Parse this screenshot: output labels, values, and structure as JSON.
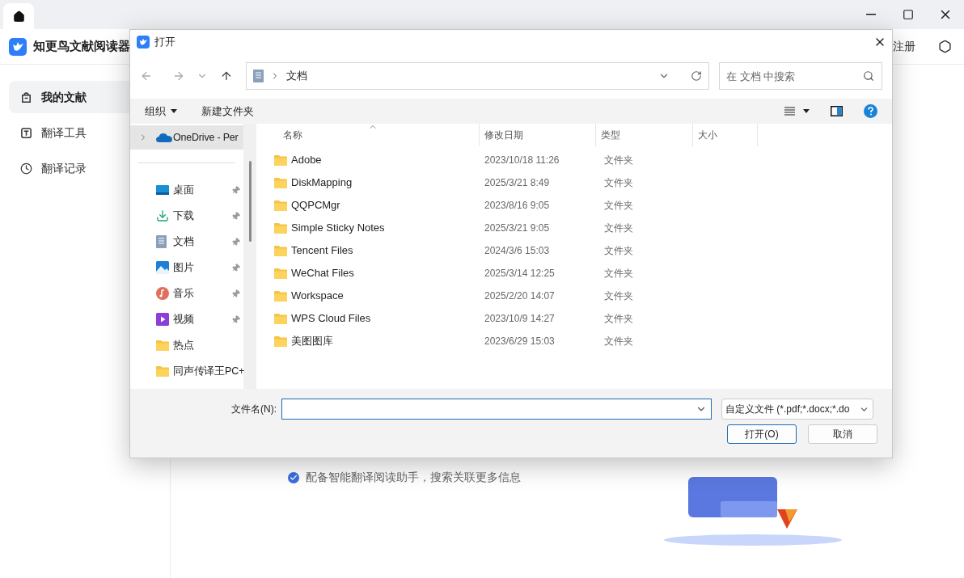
{
  "app": {
    "title": "知更鸟文献阅读器",
    "header_link": "注册",
    "sidebar": [
      {
        "label": "我的文献",
        "kind": "docs",
        "selected": true
      },
      {
        "label": "翻译工具",
        "kind": "translate",
        "selected": false
      },
      {
        "label": "翻译记录",
        "kind": "history",
        "selected": false
      }
    ],
    "option": {
      "label": "配备智能翻译阅读助手，搜索关联更多信息",
      "checked": true
    }
  },
  "dialog": {
    "title": "打开",
    "breadcrumb": "文档",
    "search": {
      "placeholder": "在 文档 中搜索"
    },
    "toolbar": [
      {
        "label": "组织",
        "dropdown": true
      },
      {
        "label": "新建文件夹",
        "dropdown": false
      }
    ],
    "nav": [
      {
        "label": "OneDrive - Per",
        "kind": "cloud",
        "pinned": false,
        "selected": true,
        "expandable": true
      },
      {
        "label": "桌面",
        "kind": "desktop",
        "pinned": true,
        "selected": false,
        "expandable": false
      },
      {
        "label": "下载",
        "kind": "download",
        "pinned": true,
        "selected": false,
        "expandable": false
      },
      {
        "label": "文档",
        "kind": "docs",
        "pinned": true,
        "selected": false,
        "expandable": false
      },
      {
        "label": "图片",
        "kind": "pictures",
        "pinned": true,
        "selected": false,
        "expandable": false
      },
      {
        "label": "音乐",
        "kind": "music",
        "pinned": true,
        "selected": false,
        "expandable": false
      },
      {
        "label": "视频",
        "kind": "video",
        "pinned": true,
        "selected": false,
        "expandable": false
      },
      {
        "label": "热点",
        "kind": "folder",
        "pinned": false,
        "selected": false,
        "expandable": false
      },
      {
        "label": "同声传译王PC+",
        "kind": "folder",
        "pinned": false,
        "selected": false,
        "expandable": false
      }
    ],
    "columns": [
      {
        "label": "名称",
        "sorted": true
      },
      {
        "label": "修改日期",
        "sorted": false
      },
      {
        "label": "类型",
        "sorted": false
      },
      {
        "label": "大小",
        "sorted": false
      }
    ],
    "rows": [
      {
        "name": "Adobe",
        "modified": "2023/10/18 11:26",
        "type": "文件夹"
      },
      {
        "name": "DiskMapping",
        "modified": "2025/3/21 8:49",
        "type": "文件夹"
      },
      {
        "name": "QQPCMgr",
        "modified": "2023/8/16 9:05",
        "type": "文件夹"
      },
      {
        "name": "Simple Sticky Notes",
        "modified": "2025/3/21 9:05",
        "type": "文件夹"
      },
      {
        "name": "Tencent Files",
        "modified": "2024/3/6 15:03",
        "type": "文件夹"
      },
      {
        "name": "WeChat Files",
        "modified": "2025/3/14 12:25",
        "type": "文件夹"
      },
      {
        "name": "Workspace",
        "modified": "2025/2/20 14:07",
        "type": "文件夹"
      },
      {
        "name": "WPS Cloud Files",
        "modified": "2023/10/9 14:27",
        "type": "文件夹"
      },
      {
        "name": "美图图库",
        "modified": "2023/6/29 15:03",
        "type": "文件夹"
      }
    ],
    "filename_label": "文件名(N):",
    "filetype": "自定义文件 (*.pdf;*.docx;*.do",
    "buttons": [
      {
        "label": "打开(O)",
        "primary": true
      },
      {
        "label": "取消",
        "primary": false
      }
    ]
  }
}
